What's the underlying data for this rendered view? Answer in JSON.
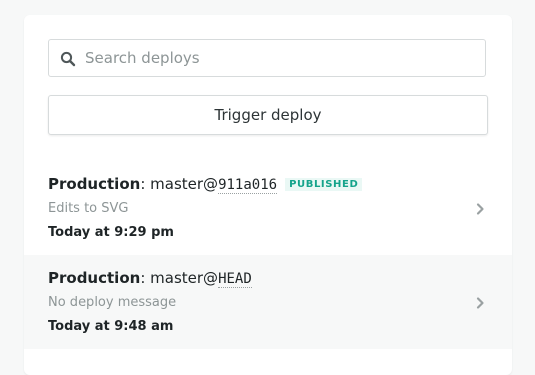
{
  "search": {
    "placeholder": "Search deploys",
    "value": "",
    "icon": "search-icon"
  },
  "trigger": {
    "label": "Trigger deploy"
  },
  "deploys": [
    {
      "context": "Production",
      "separator": ":",
      "branch": "master@",
      "ref": "911a016",
      "badge": "PUBLISHED",
      "message": "Edits to SVG",
      "time": "Today at 9:29 pm",
      "icon": "chevron-right-icon"
    },
    {
      "context": "Production",
      "separator": ":",
      "branch": "master@",
      "ref": "HEAD",
      "badge": "",
      "message": "No deploy message",
      "time": "Today at 9:48 am",
      "icon": "chevron-right-icon"
    }
  ],
  "colors": {
    "badge_text": "#14a38b",
    "badge_bg": "#eaf8f5",
    "muted_text": "#8d9596",
    "border": "#d7dbdc",
    "hover_row_bg": "#f7f8f8"
  }
}
